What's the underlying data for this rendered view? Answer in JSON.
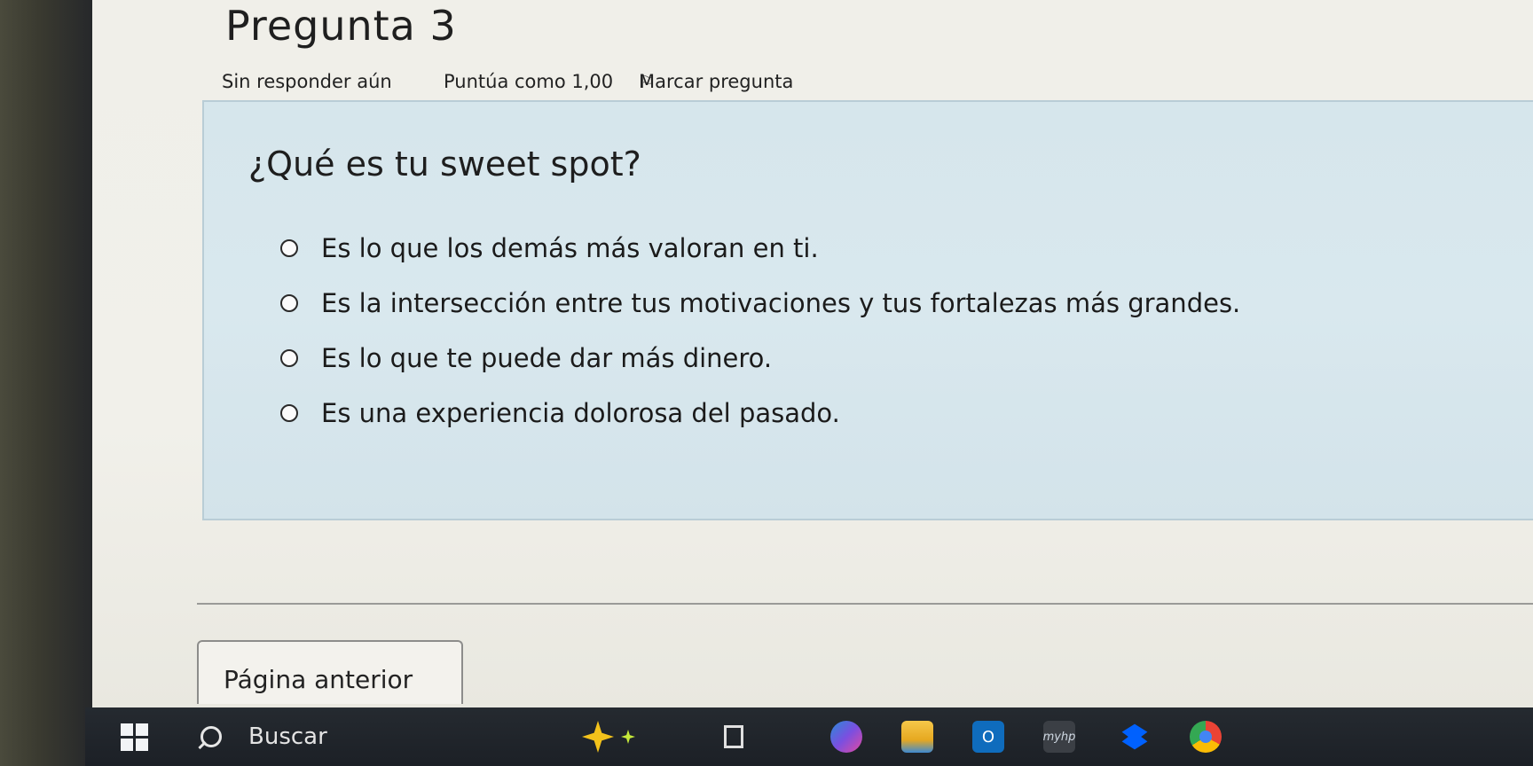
{
  "question": {
    "title": "Pregunta 3",
    "status": "Sin responder aún",
    "points": "Puntúa como 1,00",
    "flag_label": "Marcar pregunta",
    "text": "¿Qué es tu sweet spot?",
    "options": [
      "Es lo que los demás más valoran en ti.",
      "Es la intersección entre tus motivaciones y tus fortalezas más grandes.",
      "Es lo que te puede dar más dinero.",
      "Es una experiencia dolorosa del pasado."
    ]
  },
  "navigation": {
    "prev_label": "Página anterior"
  },
  "taskbar": {
    "search_placeholder": "Buscar",
    "apps": [
      "copilot-icon",
      "file-explorer-icon",
      "outlook-icon",
      "myhp-icon",
      "dropbox-icon",
      "chrome-icon"
    ],
    "outlook_glyph": "O",
    "myhp_glyph": "myhp"
  }
}
